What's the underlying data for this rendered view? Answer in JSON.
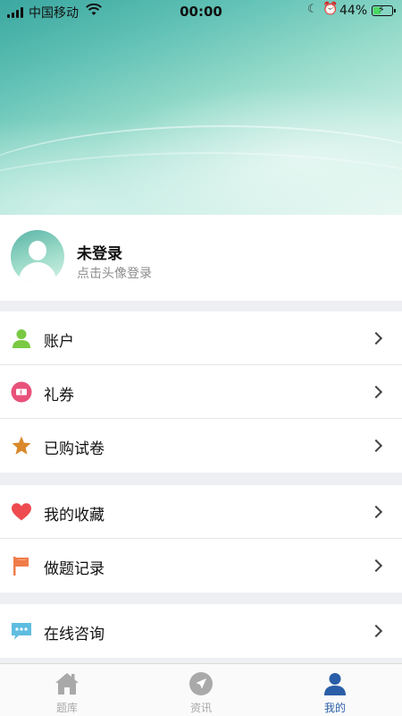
{
  "status_bar": {
    "carrier": "中国移动",
    "time": "00:00",
    "battery_percent": "44%",
    "battery_level": 0.44
  },
  "profile": {
    "name": "未登录",
    "hint": "点击头像登录"
  },
  "menu_groups": [
    {
      "items": [
        {
          "label": "账户",
          "icon": "person-icon",
          "color": "#7ac943"
        },
        {
          "label": "礼券",
          "icon": "ticket-icon",
          "color": "#e8527a"
        },
        {
          "label": "已购试卷",
          "icon": "star-icon",
          "color": "#d9892b"
        }
      ]
    },
    {
      "items": [
        {
          "label": "我的收藏",
          "icon": "heart-icon",
          "color": "#ee4b50"
        },
        {
          "label": "做题记录",
          "icon": "flag-icon",
          "color": "#f07c4a"
        }
      ]
    },
    {
      "items": [
        {
          "label": "在线咨询",
          "icon": "chat-icon",
          "color": "#5fbde0"
        }
      ]
    }
  ],
  "tabs": [
    {
      "label": "题库",
      "icon": "home-icon",
      "active": false
    },
    {
      "label": "资讯",
      "icon": "compass-icon",
      "active": false
    },
    {
      "label": "我的",
      "icon": "user-icon",
      "active": true
    }
  ],
  "colors": {
    "tab_active": "#2a5ea8",
    "tab_inactive": "#a9a9a9"
  }
}
